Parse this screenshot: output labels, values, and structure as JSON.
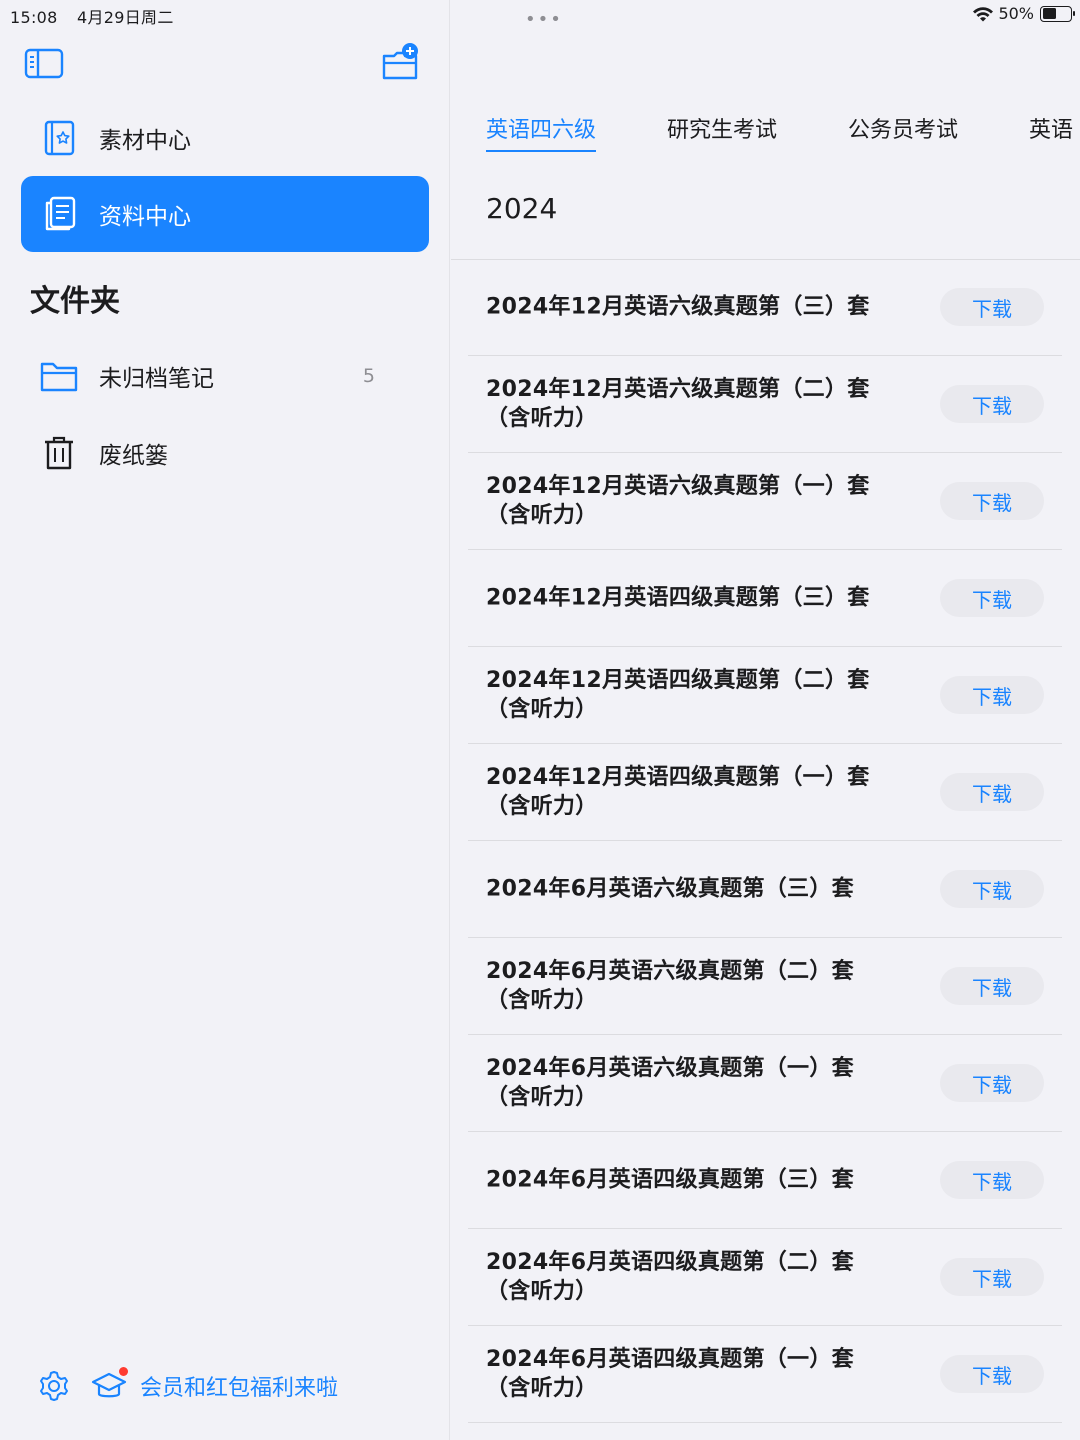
{
  "status": {
    "time": "15:08",
    "date": "4月29日周二",
    "battery": "50%",
    "battery_level": 0.5,
    "dots": "•••"
  },
  "sidebar": {
    "nav": [
      {
        "label": "素材中心",
        "icon": "material-book-icon",
        "active": false
      },
      {
        "label": "资料中心",
        "icon": "document-list-icon",
        "active": true
      }
    ],
    "section_title": "文件夹",
    "folders": [
      {
        "label": "未归档笔记",
        "count": "5",
        "icon": "folder-icon"
      },
      {
        "label": "废纸篓",
        "icon": "trash-icon"
      }
    ],
    "promo_text": "会员和红包福利来啦"
  },
  "main": {
    "tabs": [
      {
        "label": "英语四六级",
        "active": true
      },
      {
        "label": "研究生考试",
        "active": false
      },
      {
        "label": "公务员考试",
        "active": false
      },
      {
        "label": "英语",
        "active": false
      }
    ],
    "year": "2024",
    "download_label": "下载",
    "items": [
      {
        "line1": "2024年12月英语六级真题第（三）套",
        "line2": ""
      },
      {
        "line1": "2024年12月英语六级真题第（二）套",
        "line2": "（含听力）"
      },
      {
        "line1": "2024年12月英语六级真题第（一）套",
        "line2": "（含听力）"
      },
      {
        "line1": "2024年12月英语四级真题第（三）套",
        "line2": ""
      },
      {
        "line1": "2024年12月英语四级真题第（二）套",
        "line2": "（含听力）"
      },
      {
        "line1": "2024年12月英语四级真题第（一）套",
        "line2": "（含听力）"
      },
      {
        "line1": "2024年6月英语六级真题第（三）套",
        "line2": ""
      },
      {
        "line1": "2024年6月英语六级真题第（二）套",
        "line2": "（含听力）"
      },
      {
        "line1": "2024年6月英语六级真题第（一）套",
        "line2": "（含听力）"
      },
      {
        "line1": "2024年6月英语四级真题第（三）套",
        "line2": ""
      },
      {
        "line1": "2024年6月英语四级真题第（二）套",
        "line2": "（含听力）"
      },
      {
        "line1": "2024年6月英语四级真题第（一）套",
        "line2": "（含听力）"
      }
    ]
  },
  "colors": {
    "accent": "#1a84ff",
    "background": "#f2f2f7",
    "button_bg": "#e9e9ee",
    "badge_dot": "#ff3b30"
  }
}
